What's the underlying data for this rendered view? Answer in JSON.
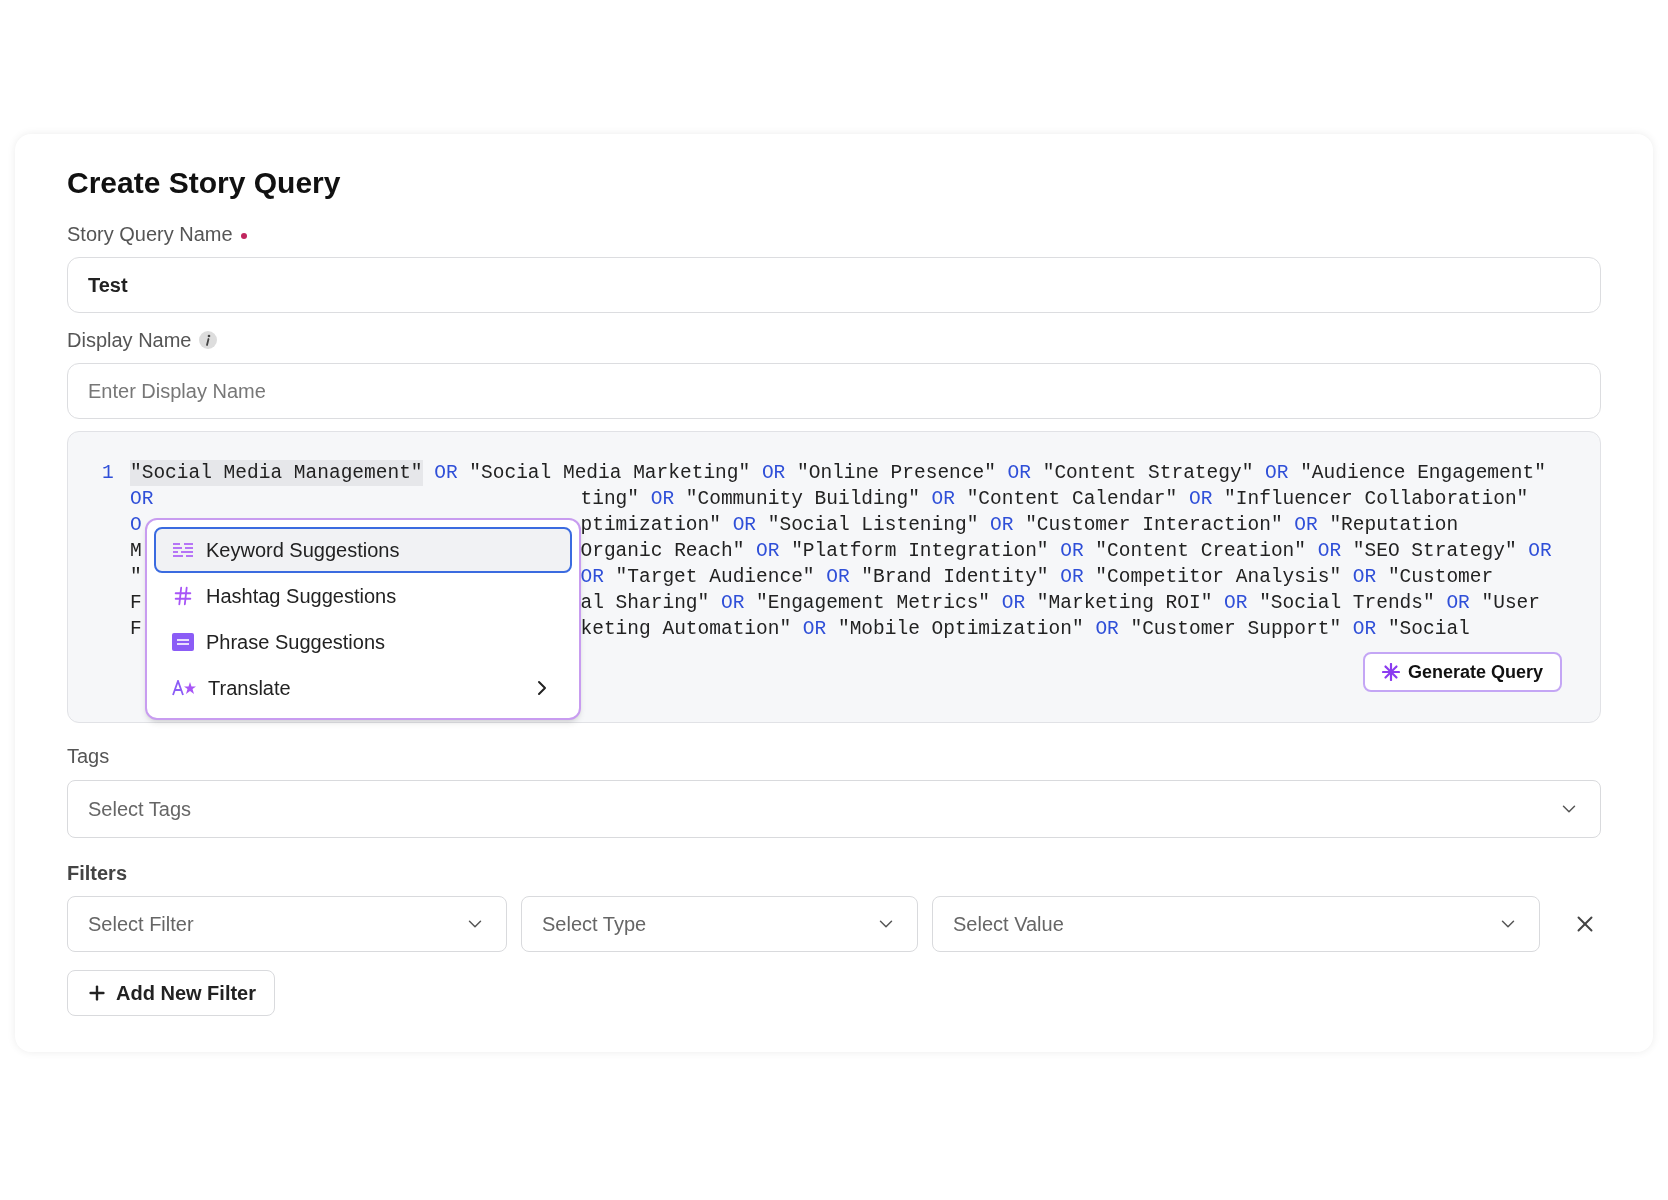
{
  "title": "Create Story Query",
  "fields": [
    {
      "label": "Story Query Name",
      "required": true,
      "info": false,
      "value": "Test"
    },
    {
      "label": "Display Name",
      "required": false,
      "info": true,
      "placeholder": "Enter Display Name"
    }
  ],
  "editor": {
    "line_number": "1",
    "rows": [
      {
        "left": [
          {
            "kind": "selection",
            "text": "\"Social Media Management\""
          },
          {
            "kind": "keyword",
            "text": "OR"
          },
          {
            "kind": "string",
            "text": "\"Social Media Marketing\""
          },
          {
            "kind": "keyword",
            "text": "OR"
          },
          {
            "kind": "string",
            "text": "\"Online Presence\""
          },
          {
            "kind": "keyword",
            "text": "OR"
          },
          {
            "kind": "string",
            "text": "\"Content Strategy\""
          },
          {
            "kind": "keyword",
            "text": "OR"
          },
          {
            "kind": "string",
            "text": "\"Audience Engagement\""
          }
        ],
        "right": []
      },
      {
        "left": [
          {
            "kind": "keyword",
            "text": "OR"
          }
        ],
        "right": [
          {
            "kind": "string",
            "text": "ting\""
          },
          {
            "kind": "keyword",
            "text": "OR"
          },
          {
            "kind": "string",
            "text": "\"Community Building\""
          },
          {
            "kind": "keyword",
            "text": "OR"
          },
          {
            "kind": "string",
            "text": "\"Content Calendar\""
          },
          {
            "kind": "keyword",
            "text": "OR"
          },
          {
            "kind": "string",
            "text": "\"Influencer Collaboration\""
          }
        ]
      },
      {
        "left": [
          {
            "kind": "keyword",
            "text": "O"
          }
        ],
        "right": [
          {
            "kind": "string",
            "text": "ptimization\""
          },
          {
            "kind": "keyword",
            "text": "OR"
          },
          {
            "kind": "string",
            "text": "\"Social Listening\""
          },
          {
            "kind": "keyword",
            "text": "OR"
          },
          {
            "kind": "string",
            "text": "\"Customer Interaction\""
          },
          {
            "kind": "keyword",
            "text": "OR"
          },
          {
            "kind": "string",
            "text": "\"Reputation"
          }
        ]
      },
      {
        "left": [
          {
            "kind": "string",
            "text": "M"
          }
        ],
        "right": [
          {
            "kind": "string",
            "text": "Organic Reach\""
          },
          {
            "kind": "keyword",
            "text": "OR"
          },
          {
            "kind": "string",
            "text": "\"Platform Integration\""
          },
          {
            "kind": "keyword",
            "text": "OR"
          },
          {
            "kind": "string",
            "text": "\"Content Creation\""
          },
          {
            "kind": "keyword",
            "text": "OR"
          },
          {
            "kind": "string",
            "text": "\"SEO Strategy\""
          },
          {
            "kind": "keyword",
            "text": "OR"
          }
        ]
      },
      {
        "left": [
          {
            "kind": "string",
            "text": "\""
          }
        ],
        "right": [
          {
            "kind": "keyword",
            "text": "OR"
          },
          {
            "kind": "string",
            "text": "\"Target Audience\""
          },
          {
            "kind": "keyword",
            "text": "OR"
          },
          {
            "kind": "string",
            "text": "\"Brand Identity\""
          },
          {
            "kind": "keyword",
            "text": "OR"
          },
          {
            "kind": "string",
            "text": "\"Competitor Analysis\""
          },
          {
            "kind": "keyword",
            "text": "OR"
          },
          {
            "kind": "string",
            "text": "\"Customer"
          }
        ]
      },
      {
        "left": [
          {
            "kind": "string",
            "text": "F"
          }
        ],
        "right": [
          {
            "kind": "string",
            "text": "al Sharing\""
          },
          {
            "kind": "keyword",
            "text": "OR"
          },
          {
            "kind": "string",
            "text": "\"Engagement Metrics\""
          },
          {
            "kind": "keyword",
            "text": "OR"
          },
          {
            "kind": "string",
            "text": "\"Marketing ROI\""
          },
          {
            "kind": "keyword",
            "text": "OR"
          },
          {
            "kind": "string",
            "text": "\"Social Trends\""
          },
          {
            "kind": "keyword",
            "text": "OR"
          },
          {
            "kind": "string",
            "text": "\"User"
          }
        ]
      },
      {
        "left": [
          {
            "kind": "string",
            "text": "F"
          }
        ],
        "right": [
          {
            "kind": "string",
            "text": "keting Automation\""
          },
          {
            "kind": "keyword",
            "text": "OR"
          },
          {
            "kind": "string",
            "text": "\"Mobile Optimization\""
          },
          {
            "kind": "keyword",
            "text": "OR"
          },
          {
            "kind": "string",
            "text": "\"Customer Support\""
          },
          {
            "kind": "keyword",
            "text": "OR"
          },
          {
            "kind": "string",
            "text": "\"Social"
          }
        ]
      }
    ],
    "menu": [
      {
        "kind": "keyword",
        "label": "Keyword Suggestions",
        "selected": true,
        "submenu": false
      },
      {
        "kind": "hashtag",
        "label": "Hashtag Suggestions",
        "selected": false,
        "submenu": false
      },
      {
        "kind": "phrase",
        "label": "Phrase Suggestions",
        "selected": false,
        "submenu": false
      },
      {
        "kind": "translate",
        "label": "Translate",
        "selected": false,
        "submenu": true
      }
    ],
    "generate_button": "Generate Query"
  },
  "tags": {
    "label": "Tags",
    "placeholder": "Select Tags"
  },
  "filters": {
    "label": "Filters",
    "selects": [
      {
        "placeholder": "Select Filter"
      },
      {
        "placeholder": "Select Type"
      },
      {
        "placeholder": "Select Value"
      }
    ],
    "add_button": "Add New Filter"
  }
}
